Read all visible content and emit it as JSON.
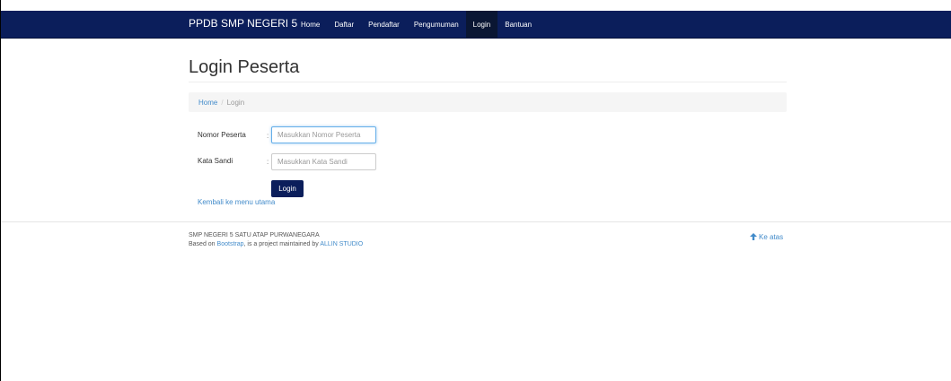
{
  "navbar": {
    "brand": "PPDB SMP NEGERI 5",
    "items": [
      {
        "label": "Home",
        "active": false
      },
      {
        "label": "Daftar",
        "active": false
      },
      {
        "label": "Pendaftar",
        "active": false
      },
      {
        "label": "Pengumuman",
        "active": false
      },
      {
        "label": "Login",
        "active": true
      },
      {
        "label": "Bantuan",
        "active": false
      }
    ]
  },
  "page": {
    "title": "Login Peserta"
  },
  "breadcrumb": {
    "home": "Home",
    "separator": "/",
    "current": "Login"
  },
  "form": {
    "nomor_label": "Nomor Peserta",
    "nomor_placeholder": "Masukkan Nomor Peserta",
    "nomor_value": "",
    "sandi_label": "Kata Sandi",
    "sandi_placeholder": "Masukkan Kata Sandi",
    "sandi_value": "",
    "colon": ":",
    "submit_label": "Login",
    "back_link": "Kembali ke menu utama"
  },
  "footer": {
    "school": "SMP NEGERI 5 SATU ATAP PURWANEGARA",
    "based_on": "Based on",
    "bootstrap_link": "Bootstrap",
    "maintained_text": ", is a project maintained by",
    "studio_link": "ALLIN STUDIO",
    "to_top": "Ke atas",
    "to_top_icon": "arrow-up-icon"
  },
  "colors": {
    "navbar_bg": "#0b1e5b",
    "nav_active_bg": "#0a1633",
    "link": "#428bca",
    "button_bg": "#0b1e5b"
  }
}
